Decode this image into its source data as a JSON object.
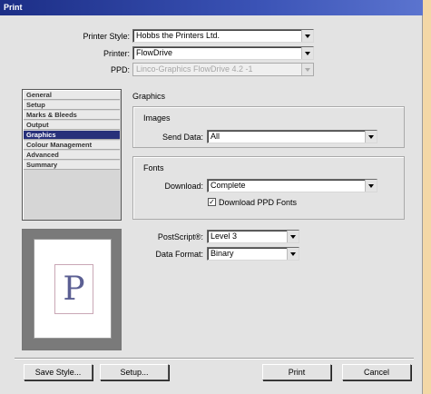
{
  "window": {
    "title": "Print"
  },
  "printer_style": {
    "label": "Printer Style:",
    "value": "Hobbs the Printers Ltd."
  },
  "printer": {
    "label": "Printer:",
    "value": "FlowDrive"
  },
  "ppd": {
    "label": "PPD:",
    "value": "Linco-Graphics FlowDrive 4.2 -1"
  },
  "sidebar": {
    "items": [
      {
        "label": "General"
      },
      {
        "label": "Setup"
      },
      {
        "label": "Marks & Bleeds"
      },
      {
        "label": "Output"
      },
      {
        "label": "Graphics",
        "selected": true
      },
      {
        "label": "Colour Management"
      },
      {
        "label": "Advanced"
      },
      {
        "label": "Summary"
      }
    ]
  },
  "preview": {
    "letter": "P"
  },
  "panel": {
    "title": "Graphics",
    "images": {
      "title": "Images",
      "send_data_label": "Send Data:",
      "send_data_value": "All"
    },
    "fonts": {
      "title": "Fonts",
      "download_label": "Download:",
      "download_value": "Complete",
      "checkbox_label": "Download PPD Fonts",
      "checkbox_checked": true,
      "checkbox_mark": "✓"
    },
    "postscript": {
      "label": "PostScript®:",
      "value": "Level 3"
    },
    "data_format": {
      "label": "Data Format:",
      "value": "Binary"
    }
  },
  "buttons": {
    "save_style": "Save Style...",
    "setup": "Setup...",
    "print": "Print",
    "cancel": "Cancel"
  }
}
